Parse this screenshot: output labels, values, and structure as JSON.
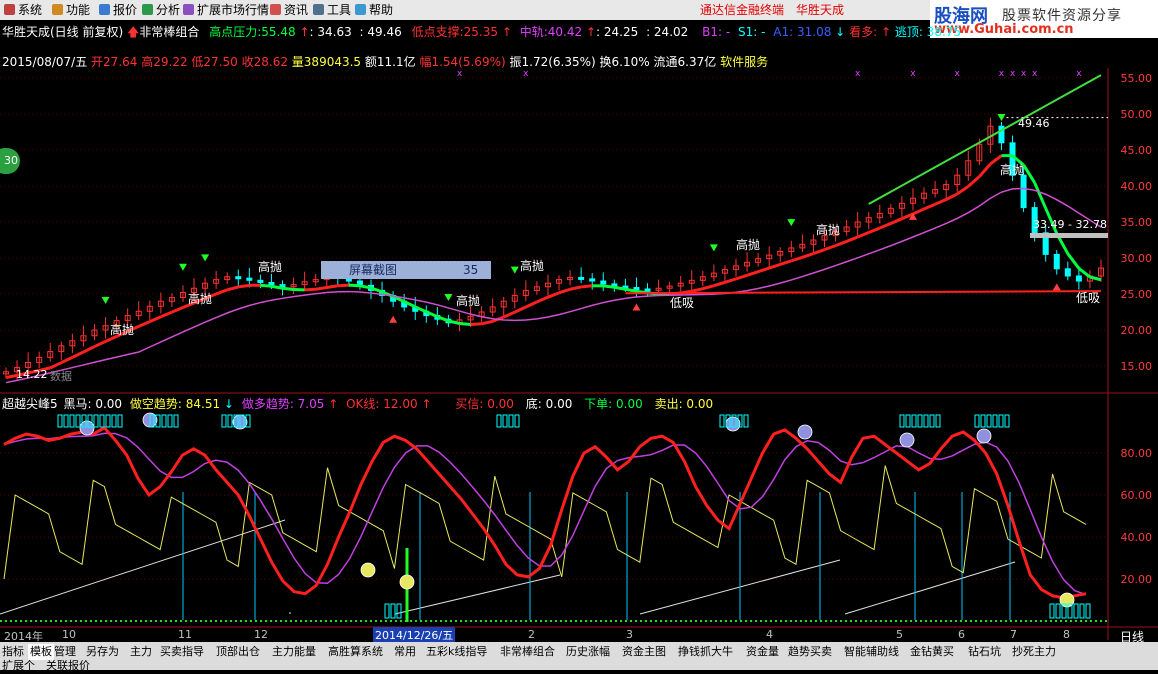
{
  "menubar": {
    "items": [
      "系统",
      "功能",
      "报价",
      "分析",
      "扩展市场行情",
      "资讯",
      "工具",
      "帮助"
    ],
    "promo": "通达信金融终端",
    "product": "华胜天成"
  },
  "brand": {
    "name": "股海网",
    "slogan": "股票软件资源分享",
    "url": "www.Guhai.com.cn"
  },
  "header": {
    "stock": "华胜天成(日线 前复权)",
    "indicator": "非常棒组合",
    "resist_label": "高点压力:",
    "resist_value": "55.48",
    "r2": ": 34.63",
    "r3": ": 49.46",
    "support_label": "低点支撑:",
    "support_value": "25.35",
    "mid_label": "中轨:",
    "mid_value": "40.42",
    "m2": ": 24.25",
    "m3": ": 24.02",
    "b1": "B1: -",
    "s1": "S1: -",
    "a1": "A1: 31.08",
    "bull": "看多:",
    "escape": "逃顶: 38.75"
  },
  "info": {
    "date": "2015/08/07/五",
    "open": "开27.64",
    "high": "高29.22",
    "low": "低27.50",
    "close": "收28.62",
    "volume": "量389043.5",
    "amount": "额11.1亿",
    "change": "幅1.54(5.69%)",
    "amp": "振1.72(6.35%)",
    "turnover": "换6.10%",
    "float": "流通6.37亿",
    "service": "软件服务"
  },
  "popup": {
    "label": "屏幕截图",
    "value": "35"
  },
  "price_labels": {
    "high_mark": "49.46",
    "range": "33.49 - 32.78",
    "low_mark": "14.22",
    "data": "数据"
  },
  "annot": {
    "sell": "高抛",
    "buy": "低吸"
  },
  "badge": "30",
  "lower": {
    "name": "超越尖峰5",
    "heima": "黑马: 0.00",
    "kong": "做空趋势: 84.51",
    "duo": "做多趋势: 7.05",
    "ok": "OK线: 12.00",
    "buy": "买信: 0.00",
    "di": "底: 0.00",
    "xiadan": "下单: 0.00",
    "maichu": "卖出: 0.00"
  },
  "price_axis": [
    "55.00",
    "50.00",
    "45.00",
    "40.00",
    "35.00",
    "30.00",
    "25.00",
    "20.00",
    "15.00"
  ],
  "osc_axis": [
    "80.00",
    "60.00",
    "40.00",
    "20.00"
  ],
  "xaxis": {
    "labels": [
      "2014年",
      "10",
      "11",
      "12",
      "2",
      "3",
      "4",
      "5",
      "6",
      "7",
      "8"
    ],
    "cursor": "2014/12/26/五",
    "period": "日线"
  },
  "tabs": [
    "指标",
    "模板",
    "管理",
    "另存为",
    "主力",
    "买卖指导",
    "顶部出仓",
    "主力能量",
    "高胜算系统",
    "常用",
    "五彩k线指导",
    "非常棒组合",
    "历史涨幅",
    "资金主图",
    "挣钱抓大牛",
    "资金量",
    "趋势买卖",
    "智能辅助线",
    "金钻黄买",
    "钻石坑",
    "抄死主力"
  ],
  "tabs2": [
    "扩展个",
    "关联报价"
  ],
  "colors": {
    "up": "#ff3232",
    "down": "#00ffff",
    "trend_up": "#ff2020",
    "trend_dn": "#00ff40",
    "accent": "#ff0000"
  },
  "chart_data": {
    "type": "line",
    "price_ylim": [
      12,
      58
    ],
    "closes": [
      14.2,
      14.8,
      15.5,
      16.2,
      17.0,
      17.8,
      18.5,
      19.2,
      20.0,
      20.6,
      21.3,
      22.0,
      22.6,
      23.3,
      24.0,
      24.5,
      25.2,
      25.8,
      26.5,
      27.0,
      27.4,
      27.2,
      26.9,
      26.6,
      26.3,
      26.0,
      26.3,
      26.7,
      27.0,
      27.5,
      27.2,
      26.8,
      26.2,
      25.5,
      24.8,
      24.0,
      23.2,
      22.6,
      22.0,
      21.5,
      21.0,
      21.4,
      21.9,
      22.5,
      23.2,
      24.0,
      24.8,
      25.5,
      26.0,
      26.5,
      27.0,
      27.3,
      27.1,
      26.8,
      26.4,
      26.1,
      25.9,
      25.7,
      25.6,
      25.8,
      26.1,
      26.5,
      26.9,
      27.4,
      27.9,
      28.4,
      28.9,
      29.4,
      29.9,
      30.4,
      30.9,
      31.4,
      31.9,
      32.5,
      33.1,
      33.7,
      34.3,
      35.0,
      35.6,
      36.2,
      36.9,
      37.6,
      38.3,
      39.0,
      39.5,
      40.2,
      41.5,
      43.5,
      45.8,
      48.3,
      46.0,
      41.5,
      37.0,
      33.5,
      30.5,
      28.5,
      27.5,
      26.8,
      27.5,
      28.6
    ],
    "osc_series": [
      84,
      87,
      89,
      88,
      86,
      87,
      89,
      90,
      89,
      92,
      86,
      79,
      68,
      60,
      64,
      71,
      79,
      82,
      79,
      72,
      66,
      60,
      50,
      39,
      28,
      19,
      14,
      13,
      17,
      27,
      40,
      52,
      65,
      76,
      85,
      88,
      86,
      82,
      76,
      70,
      64,
      58,
      51,
      44,
      36,
      27,
      22,
      21,
      25,
      36,
      53,
      69,
      80,
      83,
      78,
      72,
      76,
      83,
      87,
      88,
      85,
      76,
      64,
      55,
      48,
      44,
      56,
      68,
      80,
      89,
      91,
      87,
      82,
      76,
      70,
      66,
      78,
      87,
      88,
      84,
      80,
      76,
      72,
      75,
      82,
      88,
      90,
      86,
      80,
      70,
      55,
      38,
      22,
      15,
      12,
      11,
      12,
      13
    ],
    "ok_line": 12.0
  }
}
